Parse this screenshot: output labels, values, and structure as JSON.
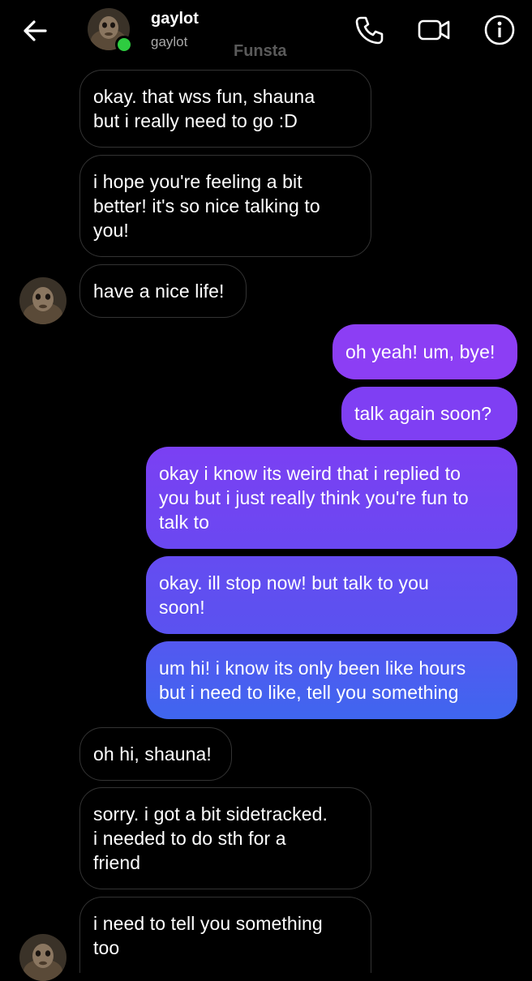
{
  "header": {
    "name": "gaylot",
    "username": "gaylot",
    "watermark": "Funsta"
  },
  "icons": {
    "back": "arrow-left-icon",
    "call": "phone-icon",
    "video": "video-camera-icon",
    "info": "info-icon"
  },
  "colors": {
    "background": "#000000",
    "sent_gradient_start": "#8a3cf3",
    "sent_gradient_end": "#3d63f0",
    "received_border": "#333333",
    "online": "#2ecc40"
  },
  "messages": [
    {
      "from": "them",
      "text": "okay. that wss fun, shauna\nbut i really need to go :D"
    },
    {
      "from": "them",
      "text": "i hope you're feeling a bit\nbetter! it's so nice talking to\nyou!"
    },
    {
      "from": "them",
      "text": "have a nice life!"
    },
    {
      "from": "me",
      "text": "oh yeah! um, bye!"
    },
    {
      "from": "me",
      "text": "talk again soon?"
    },
    {
      "from": "me",
      "text": "okay i know its weird that i replied to\nyou but i just really think you're fun to\ntalk to"
    },
    {
      "from": "me",
      "text": "okay. ill stop now! but talk to you\nsoon!"
    },
    {
      "from": "me",
      "text": "um hi! i know its only been like hours\nbut i need to like, tell you something"
    },
    {
      "from": "them",
      "text": "oh hi, shauna!"
    },
    {
      "from": "them",
      "text": "sorry. i got a bit sidetracked.\ni needed to do sth for a\nfriend"
    },
    {
      "from": "them",
      "text": "i need to tell you something\ntoo"
    }
  ]
}
